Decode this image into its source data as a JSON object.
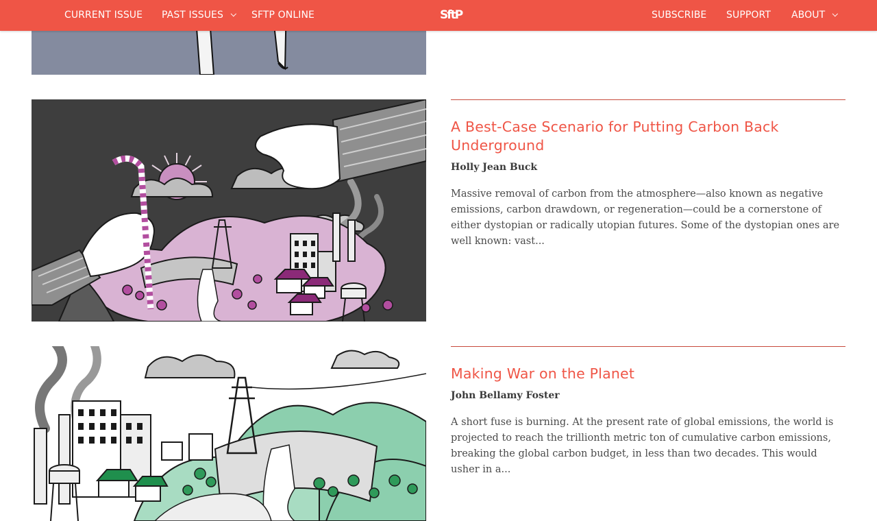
{
  "nav": {
    "left": [
      {
        "label": "CURRENT ISSUE"
      },
      {
        "label": "PAST ISSUES"
      },
      {
        "label": "SFTP ONLINE"
      }
    ],
    "logo_text": "SftP",
    "right": [
      {
        "label": "SUBSCRIBE"
      },
      {
        "label": "SUPPORT"
      },
      {
        "label": "ABOUT"
      }
    ]
  },
  "colors": {
    "brand": "#ef5546",
    "pink_illustration": "#c98fc0",
    "green_illustration": "#8ccfae"
  },
  "articles": [
    {
      "title": "A Best-Case Scenario for Putting Carbon Back Underground",
      "author": "Holly Jean Buck",
      "excerpt": "Massive removal of carbon from the atmosphere—also known as negative emissions, carbon drawdown, or regeneration—could be a cornerstone of either dystopian or radically utopian futures. Some of the dystopian ones are well known: vast..."
    },
    {
      "title": "Making War on the Planet",
      "author": "John Bellamy Foster",
      "excerpt": "A short fuse is burning. At the present rate of global emissions, the world is projected to reach the trillionth metric ton of cumulative carbon emissions, breaking the global carbon budget, in less than two decades. This would usher in a..."
    }
  ]
}
